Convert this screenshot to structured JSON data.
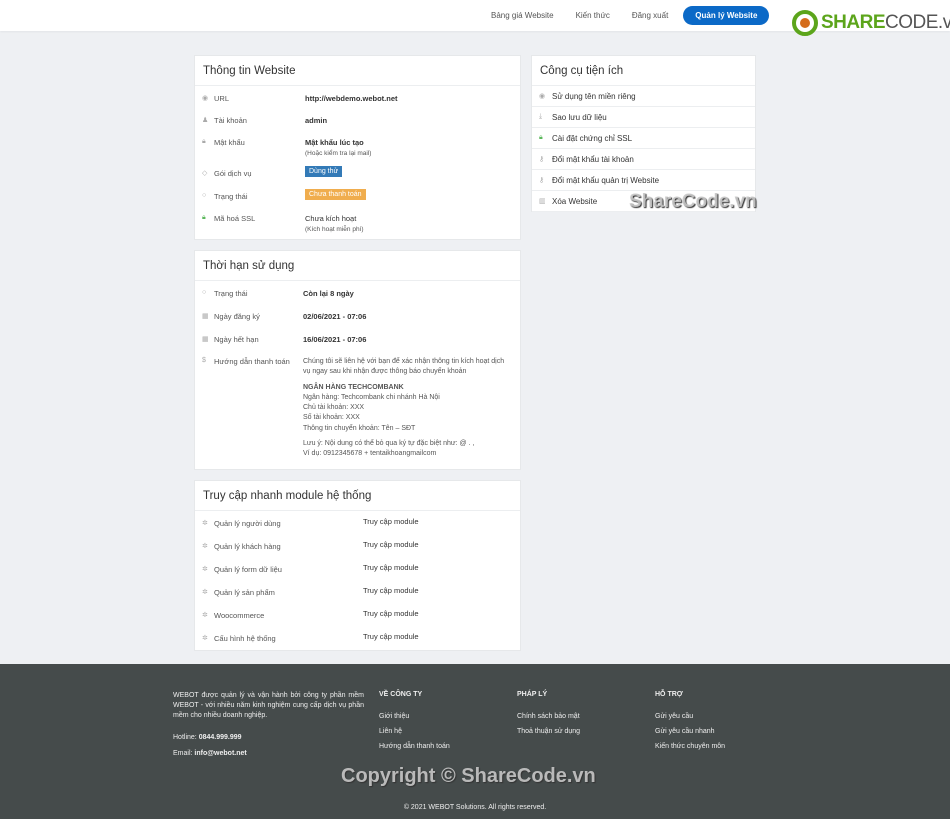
{
  "nav": {
    "items": [
      "Bảng giá Website",
      "Kiến thức",
      "Đăng xuất"
    ],
    "primary": "Quản lý Website"
  },
  "logo": {
    "text_bold": "SHARE",
    "text_rest": "CODE.vn"
  },
  "info": {
    "title": "Thông tin Website",
    "rows": [
      {
        "icon": "globe-icon",
        "label": "URL",
        "value": "http://webdemo.webot.net"
      },
      {
        "icon": "user-icon",
        "label": "Tài khoản",
        "value": "admin"
      },
      {
        "icon": "lock-icon",
        "label": "Mật khẩu",
        "value": "Mật khẩu lúc tạo",
        "note": "(Hoặc kiểm tra lại mail)"
      },
      {
        "icon": "diamond-icon",
        "label": "Gói dịch vụ",
        "value": "Dùng thử",
        "badge_color": "#337ab7"
      },
      {
        "icon": "circle-icon",
        "label": "Trạng thái",
        "value": "Chưa thanh toán",
        "badge_color": "#f0ad4e"
      },
      {
        "icon": "lock-icon",
        "label": "Mã hoá SSL",
        "value": "Chưa kích hoạt",
        "note": "(Kích hoạt miễn phí)"
      }
    ]
  },
  "term": {
    "title": "Thời hạn sử dụng",
    "rows": [
      {
        "icon": "circle-icon",
        "label": "Trạng thái",
        "value": "Còn lại 8 ngày"
      },
      {
        "icon": "calendar-icon",
        "label": "Ngày đăng ký",
        "value": "02/06/2021 - 07:06"
      },
      {
        "icon": "calendar-icon",
        "label": "Ngày hết hạn",
        "value": "16/06/2021 - 07:06"
      }
    ],
    "payment": {
      "icon": "dollar-icon",
      "label": "Hướng dẫn thanh toán",
      "intro": "Chúng tôi sẽ liên hệ với bạn để xác nhận thông tin kích hoạt dịch vụ ngay sau khi nhận được thông báo chuyển khoản",
      "bank_title": "NGÂN HÀNG TECHCOMBANK",
      "lines": [
        "Ngân hàng: Techcombank chi nhánh Hà Nội",
        "Chủ tài khoản: XXX",
        "Số tài khoản: XXX",
        "Thông tin chuyển khoản: Tên – SĐT"
      ],
      "note1": "Lưu ý: Nội dung có thể bỏ qua ký tự đặc biệt như: @ . ,",
      "note2": "Ví dụ: 0912345678 + tentaikhoangmailcom"
    }
  },
  "modules": {
    "title": "Truy cập nhanh module hệ thống",
    "link": "Truy cập module",
    "rows": [
      "Quản lý người dùng",
      "Quản lý khách hàng",
      "Quản lý form dữ liệu",
      "Quản lý sản phẩm",
      "Woocommerce",
      "Cấu hình hệ thống"
    ]
  },
  "tools": {
    "title": "Công cụ tiện ích",
    "items": [
      {
        "icon": "globe-icon",
        "label": "Sử dụng tên miền riêng"
      },
      {
        "icon": "download-icon",
        "label": "Sao lưu dữ liệu"
      },
      {
        "icon": "lock-icon",
        "label": "Cài đặt chứng chỉ SSL",
        "color": "#5cb85c"
      },
      {
        "icon": "key-icon",
        "label": "Đổi mật khẩu tài khoản"
      },
      {
        "icon": "key-icon",
        "label": "Đổi mật khẩu quản trị Website"
      },
      {
        "icon": "trash-icon",
        "label": "Xóa Website"
      }
    ]
  },
  "footer": {
    "about": "WEBOT được quản lý và vận hành bởi công ty phần mềm WEBOT - với nhiều năm kinh nghiệm cung cấp dịch vụ phần mềm cho nhiều doanh nghiệp.",
    "hotline_label": "Hotline:",
    "hotline": "0844.999.999",
    "email_label": "Email:",
    "email": "info@webot.net",
    "cols": [
      {
        "title": "VỀ CÔNG TY",
        "links": [
          "Giới thiệu",
          "Liên hệ",
          "Hướng dẫn thanh toán"
        ]
      },
      {
        "title": "PHÁP LÝ",
        "links": [
          "Chính sách bảo mật",
          "Thoả thuận sử dụng"
        ]
      },
      {
        "title": "HỖ TRỢ",
        "links": [
          "Gửi yêu cầu",
          "Gửi yêu cầu nhanh",
          "Kiến thức chuyên môn"
        ]
      }
    ],
    "copyright": "© 2021 WEBOT Solutions. All rights reserved."
  },
  "watermarks": [
    "ShareCode.vn",
    "Copyright © ShareCode.vn"
  ]
}
